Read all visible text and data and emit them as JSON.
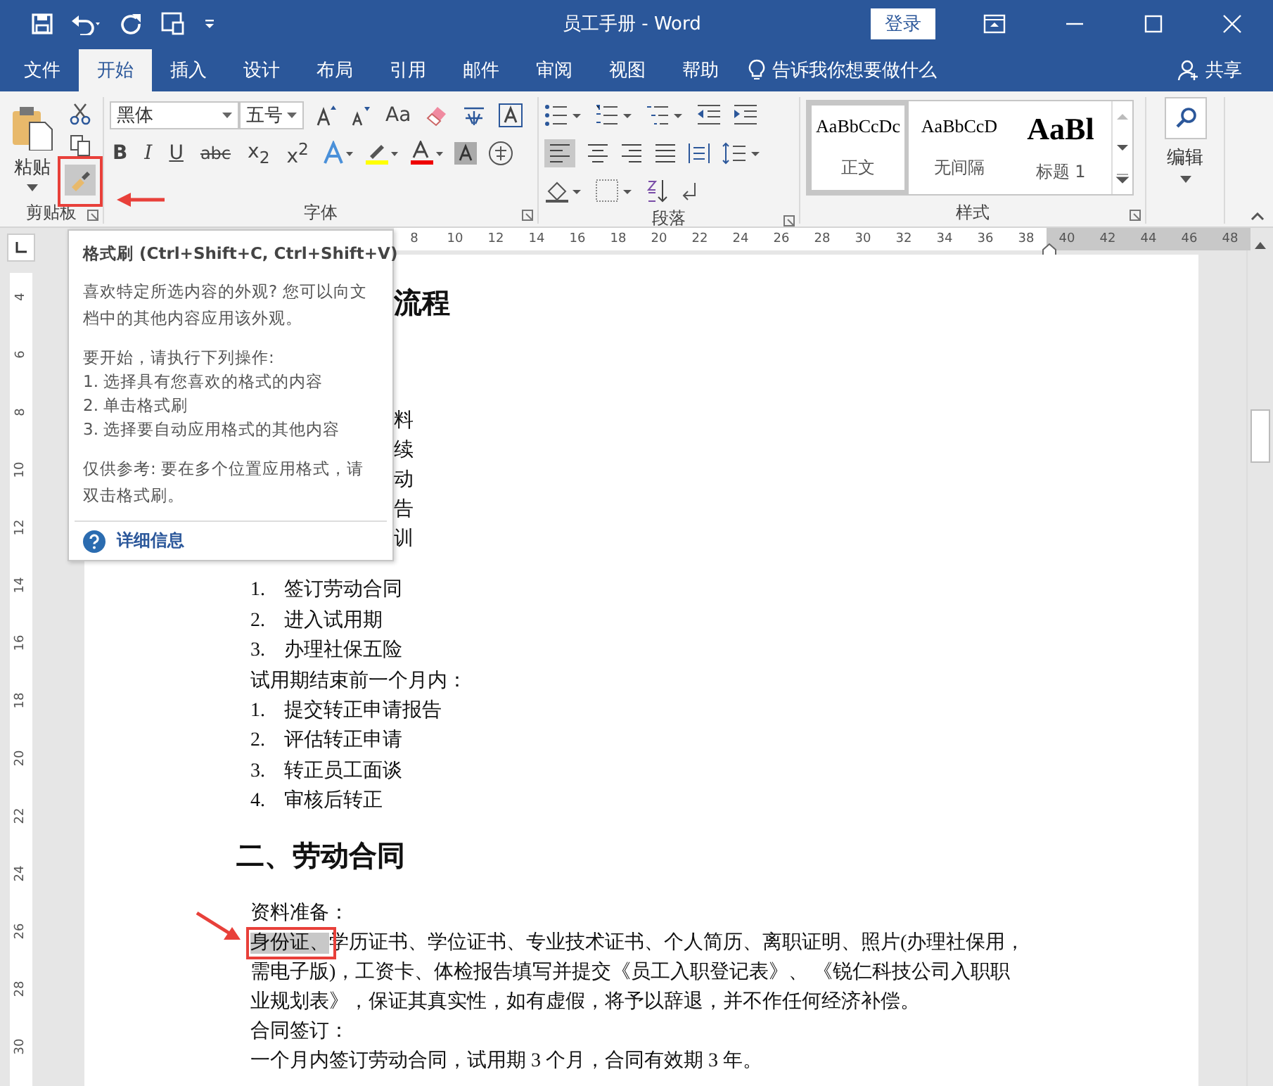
{
  "title_bar": {
    "title": "员工手册 - Word",
    "sign_in": "登录"
  },
  "tabs": [
    {
      "label": "文件",
      "selected": false
    },
    {
      "label": "开始",
      "selected": true
    },
    {
      "label": "插入",
      "selected": false
    },
    {
      "label": "设计",
      "selected": false
    },
    {
      "label": "布局",
      "selected": false
    },
    {
      "label": "引用",
      "selected": false
    },
    {
      "label": "邮件",
      "selected": false
    },
    {
      "label": "审阅",
      "selected": false
    },
    {
      "label": "视图",
      "selected": false
    },
    {
      "label": "帮助",
      "selected": false
    }
  ],
  "tell_me": "告诉我你想要做什么",
  "share": "共享",
  "clipboard": {
    "paste": "粘贴",
    "label": "剪贴板"
  },
  "font": {
    "name": "黑体",
    "size": "五号",
    "change_case": "Aa",
    "format_buttons": [
      "B",
      "I",
      "U",
      "abc",
      "x$_{2}$",
      "x$^{2}$"
    ],
    "label": "字体"
  },
  "paragraph": {
    "label": "段落"
  },
  "styles": {
    "items": [
      {
        "preview": "AaBbCcDc",
        "name": "正文",
        "selected": true
      },
      {
        "preview": "AaBbCcD",
        "name": "无间隔",
        "selected": false
      },
      {
        "preview": "AaBl",
        "name": "标题 1",
        "selected": false
      }
    ],
    "label": "样式"
  },
  "editing": {
    "label": "编辑"
  },
  "ruler": {
    "h_ticks": [
      "8",
      "10",
      "12",
      "14",
      "16",
      "18",
      "20",
      "22",
      "24",
      "26",
      "28",
      "30",
      "32",
      "34",
      "36",
      "38",
      "40",
      "42",
      "44",
      "46",
      "48"
    ],
    "v_ticks": [
      "4",
      "6",
      "8",
      "10",
      "12",
      "14",
      "16",
      "18",
      "20",
      "22",
      "24",
      "26",
      "28",
      "30"
    ]
  },
  "tooltip": {
    "title": "格式刷 (Ctrl+Shift+C, Ctrl+Shift+V)",
    "intro": "喜欢特定所选内容的外观? 您可以向文档中的其他内容应用该外观。",
    "steps_title": "要开始，请执行下列操作:",
    "steps": [
      "1. 选择具有您喜欢的格式的内容",
      "2. 单击格式刷",
      "3. 选择要自动应用格式的其他内容"
    ],
    "note": "仅供参考: 要在多个位置应用格式，请双击格式刷。",
    "link": "详细信息"
  },
  "document": {
    "covered": [
      {
        "kind": "heading",
        "text": "流程"
      },
      {
        "kind": "para",
        "text": "料"
      },
      {
        "kind": "para",
        "text": "续"
      },
      {
        "kind": "para",
        "text": "动"
      },
      {
        "kind": "para",
        "text": "告"
      },
      {
        "kind": "para",
        "text": "训"
      }
    ],
    "lines": [
      {
        "kind": "item",
        "number": "1.",
        "text": "签订劳动合同"
      },
      {
        "kind": "item",
        "number": "2.",
        "text": "进入试用期"
      },
      {
        "kind": "item",
        "number": "3.",
        "text": "办理社保五险"
      },
      {
        "kind": "para",
        "text": "试用期结束前一个月内："
      },
      {
        "kind": "item",
        "number": "1.",
        "text": "提交转正申请报告"
      },
      {
        "kind": "item",
        "number": "2.",
        "text": "评估转正申请"
      },
      {
        "kind": "item",
        "number": "3.",
        "text": "转正员工面谈"
      },
      {
        "kind": "item",
        "number": "4.",
        "text": "审核后转正"
      },
      {
        "kind": "heading",
        "text": "二、劳动合同"
      },
      {
        "kind": "para",
        "text": "资料准备："
      },
      {
        "kind": "para",
        "highlight": "身份证、",
        "text": "学历证书、学位证书、专业技术证书、个人简历、离职证明、照片(办理社保用，需电子版)，工资卡、体检报告填写并提交《员工入职登记表》、 《锐仁科技公司入职职业规划表》，保证其真实性，如有虚假，将予以辞退，并不作任何经济补偿。"
      },
      {
        "kind": "para",
        "text": "合同签订："
      },
      {
        "kind": "para",
        "text": "一个月内签订劳动合同，试用期 3 个月，合同有效期 3 年。"
      }
    ]
  }
}
